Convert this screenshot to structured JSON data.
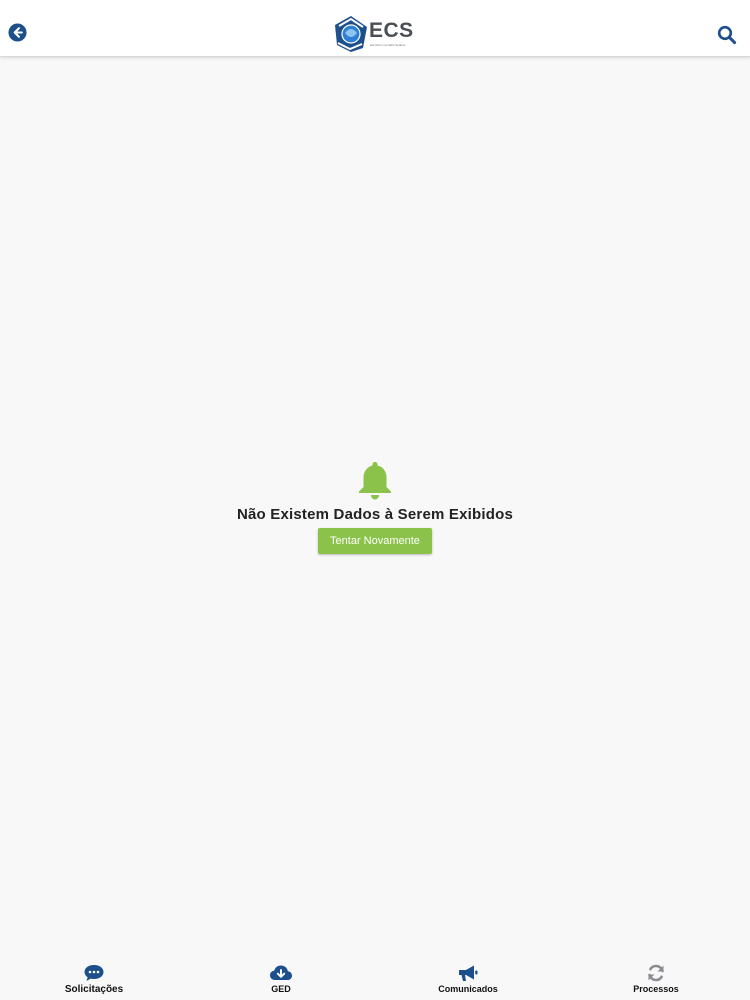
{
  "header": {
    "logo_text": "ECS",
    "logo_subtitle": "Escritório Contábil Spaboé",
    "brand_color": "#1c4f8c"
  },
  "icons": {
    "back": "arrow-left-circle-icon",
    "search": "search-icon",
    "bell": "bell-icon"
  },
  "empty_state": {
    "message": "Não Existem Dados à Serem Exibidos",
    "retry_label": "Tentar Novamente",
    "accent_color": "#8bc34a"
  },
  "tabs": [
    {
      "label": "Solicitações",
      "icon": "chat-bubble-icon"
    },
    {
      "label": "GED",
      "icon": "cloud-download-icon"
    },
    {
      "label": "Comunicados",
      "icon": "megaphone-icon"
    },
    {
      "label": "Processos",
      "icon": "refresh-icon"
    }
  ]
}
